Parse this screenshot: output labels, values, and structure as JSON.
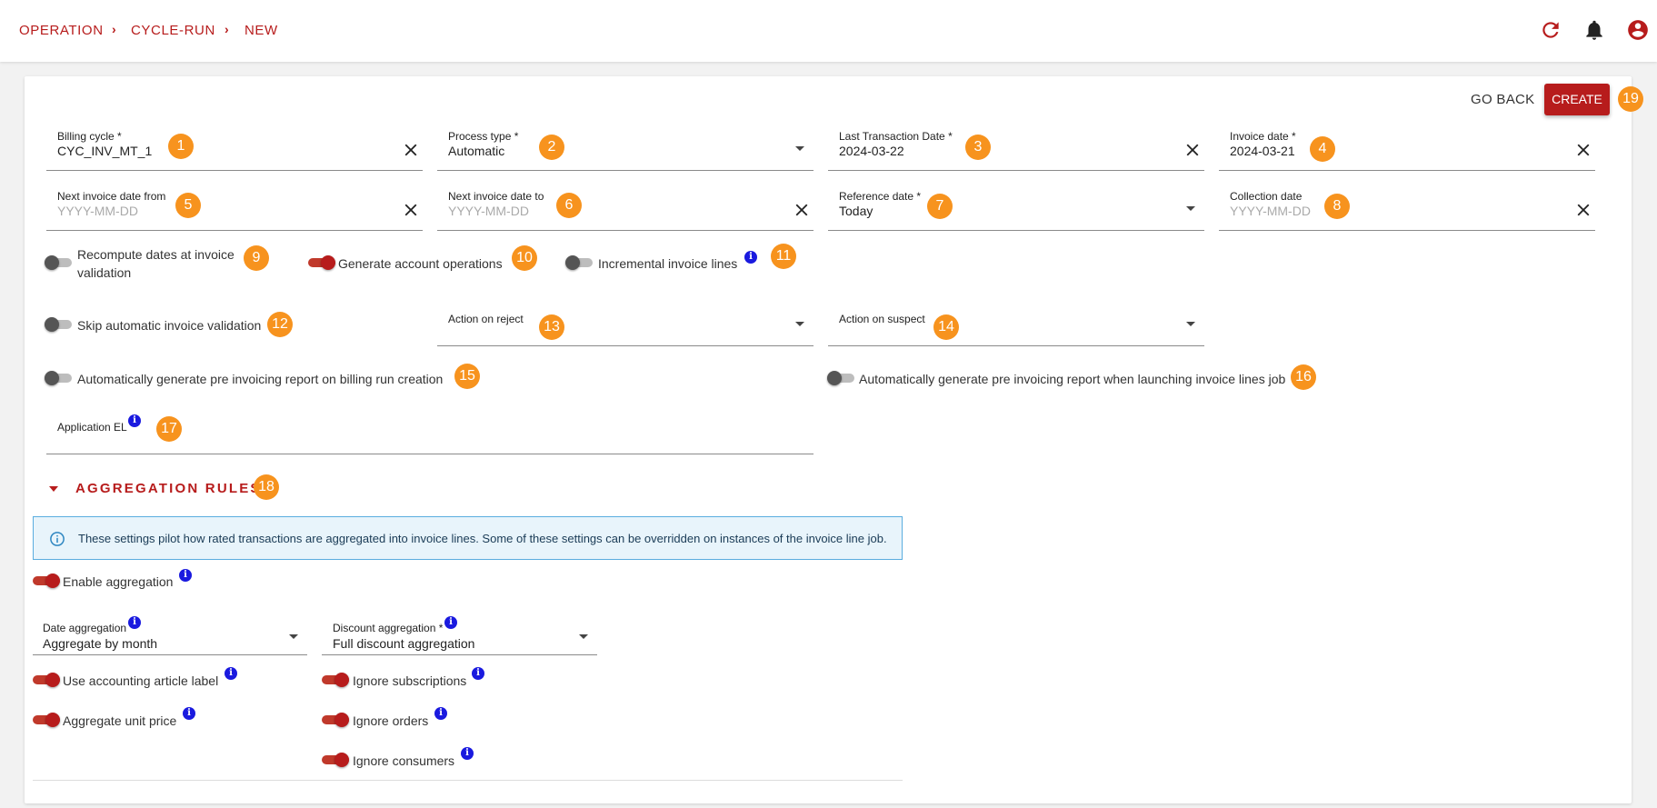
{
  "breadcrumb": [
    "OPERATION",
    "CYCLE-RUN",
    "NEW"
  ],
  "header_icons": [
    "refresh-icon",
    "bell-icon",
    "account-circle-icon"
  ],
  "actions": {
    "go_back": "GO BACK",
    "create": "CREATE"
  },
  "fields": {
    "billing_cycle": {
      "label": "Billing cycle *",
      "value": "CYC_INV_MT_1"
    },
    "process_type": {
      "label": "Process type *",
      "value": "Automatic"
    },
    "last_transaction_date": {
      "label": "Last Transaction Date *",
      "value": "2024-03-22"
    },
    "invoice_date": {
      "label": "Invoice date *",
      "value": "2024-03-21"
    },
    "next_invoice_date_from": {
      "label": "Next invoice date from",
      "placeholder": "YYYY-MM-DD"
    },
    "next_invoice_date_to": {
      "label": "Next invoice date to",
      "placeholder": "YYYY-MM-DD"
    },
    "reference_date": {
      "label": "Reference date *",
      "value": "Today"
    },
    "collection_date": {
      "label": "Collection date",
      "placeholder": "YYYY-MM-DD"
    },
    "action_on_reject": {
      "label": "Action on reject",
      "value": ""
    },
    "action_on_suspect": {
      "label": "Action on suspect",
      "value": ""
    },
    "application_el": {
      "label": "Application EL",
      "value": ""
    }
  },
  "toggles": {
    "recompute_dates_line1": "Recompute dates at invoice",
    "recompute_dates_line2": "validation",
    "generate_account_operations": "Generate account operations",
    "incremental_invoice_lines": "Incremental invoice lines",
    "skip_automatic_invoice_validation": "Skip automatic invoice validation",
    "auto_pre_invoicing_billing_run": "Automatically generate pre invoicing report on billing run creation",
    "auto_pre_invoicing_invoice_lines": "Automatically generate pre invoicing report when launching invoice lines job"
  },
  "toggle_states": {
    "recompute_dates": false,
    "generate_account_operations": true,
    "incremental_invoice_lines": false,
    "skip_automatic_invoice_validation": false,
    "auto_pre_invoicing_billing_run": false,
    "auto_pre_invoicing_invoice_lines": false,
    "enable_aggregation": true,
    "use_accounting_article_label": true,
    "aggregate_unit_price": true,
    "ignore_subscriptions": true,
    "ignore_orders": true,
    "ignore_consumers": true
  },
  "aggregation": {
    "title": "AGGREGATION RULES",
    "info_text": "These settings pilot how rated transactions are aggregated into invoice lines. Some of these settings can be overridden on instances of the invoice line job.",
    "enable_aggregation": "Enable aggregation",
    "date_aggregation": {
      "label": "Date aggregation",
      "value": "Aggregate by month"
    },
    "discount_aggregation": {
      "label": "Discount aggregation *",
      "value": "Full discount aggregation"
    },
    "use_accounting_article_label": "Use accounting article label",
    "aggregate_unit_price": "Aggregate unit price",
    "ignore_subscriptions": "Ignore subscriptions",
    "ignore_orders": "Ignore orders",
    "ignore_consumers": "Ignore consumers"
  },
  "badges": [
    "1",
    "2",
    "3",
    "4",
    "5",
    "6",
    "7",
    "8",
    "9",
    "10",
    "11",
    "12",
    "13",
    "14",
    "15",
    "16",
    "17",
    "18",
    "19"
  ],
  "info_glyph": "i",
  "colors": {
    "accent": "#b71c1c",
    "badge": "#f7931e",
    "info": "#1a1adf",
    "alert_bg": "#e8f4fb",
    "alert_border": "#5aaddf"
  }
}
